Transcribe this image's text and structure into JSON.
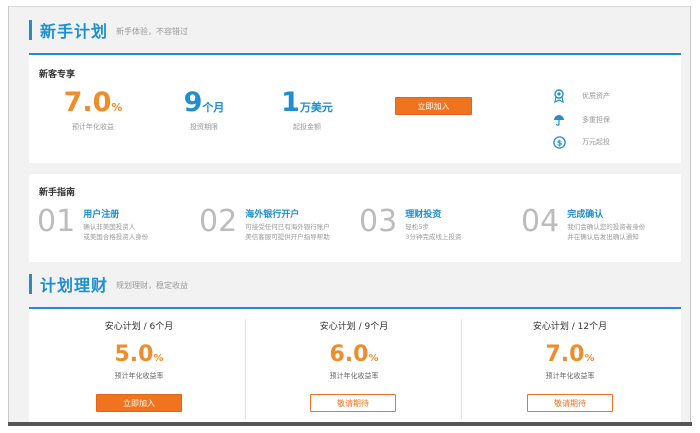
{
  "newbie_section": {
    "title": "新手计划",
    "subtitle": "新手体验，不容错过"
  },
  "exclusive": {
    "label": "新客专享",
    "stats": [
      {
        "value": "7.0",
        "unit": "%",
        "caption": "预计年化收益"
      },
      {
        "value": "9",
        "unit": "个月",
        "caption": "投资期限"
      },
      {
        "value": "1",
        "unit": "万美元",
        "caption": "起投金额"
      }
    ],
    "join_label": "立即加入",
    "features": [
      {
        "icon": "badge-icon",
        "label": "优质资产"
      },
      {
        "icon": "umbrella-icon",
        "label": "多重担保"
      },
      {
        "icon": "dollar-icon",
        "label": "万元起投"
      }
    ]
  },
  "guide": {
    "label": "新手指南",
    "steps": [
      {
        "num": "01",
        "title": "用户注册",
        "desc1": "确认非美国投资人",
        "desc2": "或美国合格投资人身份"
      },
      {
        "num": "02",
        "title": "海外银行开户",
        "desc1": "可接受任何已有海外银行账户",
        "desc2": "美信客服可提供开户指导帮助"
      },
      {
        "num": "03",
        "title": "理财投资",
        "desc1": "轻松5步",
        "desc2": "3分钟完成线上投资"
      },
      {
        "num": "04",
        "title": "完成确认",
        "desc1": "我们会确认您的投资者身份",
        "desc2": "并在确认后发出确认通知"
      }
    ]
  },
  "plans_section": {
    "title": "计划理财",
    "subtitle": "规划理财，稳定收益"
  },
  "plans": [
    {
      "title": "安心计划 / 6个月",
      "rate": "5.0",
      "pct": "%",
      "caption": "预计年化收益率",
      "button": "立即加入",
      "button_style": "filled"
    },
    {
      "title": "安心计划 / 9个月",
      "rate": "6.0",
      "pct": "%",
      "caption": "预计年化收益率",
      "button": "敬请期待",
      "button_style": "outline"
    },
    {
      "title": "安心计划 / 12个月",
      "rate": "7.0",
      "pct": "%",
      "caption": "预计年化收益率",
      "button": "敬请期待",
      "button_style": "outline"
    }
  ],
  "colors": {
    "accent": "#1e8fcf",
    "orange": "#f0741f",
    "rate_orange": "#f08c2a"
  }
}
